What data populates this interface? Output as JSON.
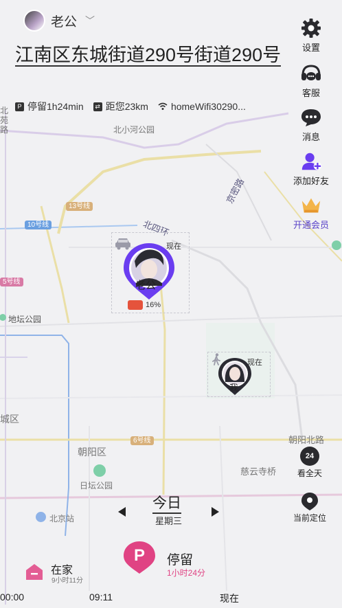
{
  "header": {
    "user_name": "老公",
    "address": "江南区东城街道290号街道290号",
    "info": {
      "stay": "停留1h24min",
      "distance": "距您23km",
      "wifi": "homeWifi30290..."
    }
  },
  "right_menu": [
    {
      "label": "设置",
      "icon": "gear-icon"
    },
    {
      "label": "客服",
      "icon": "headset-icon"
    },
    {
      "label": "消息",
      "icon": "chat-bubble-icon"
    },
    {
      "label": "添加好友",
      "icon": "add-friend-icon"
    },
    {
      "label": "开通会员",
      "icon": "crown-icon"
    }
  ],
  "map_labels": {
    "beixiaohe_park": "北小河公园",
    "line13": "13号线",
    "line10": "10号线",
    "line5": "5号线",
    "jingmi_road": "京密路",
    "north_4th_ring": "北四环",
    "ditan_park": "地坛公园",
    "line6": "6号线",
    "chaoyang_district": "朝阳区",
    "ritan_park": "日坛公园",
    "beijing_station": "北京站",
    "ciyun_temple_bridge": "慈云寺桥",
    "chaoyang_north_road": "朝阳北路",
    "district_left": "城区",
    "top_left_chars": "北",
    "top_left_chars2": "苑",
    "top_left_chars3": "路"
  },
  "markers": {
    "husband": {
      "name": "老公",
      "now": "现在",
      "battery": "16%",
      "mode_icon": "car-icon"
    },
    "me": {
      "name": "我",
      "now": "现在",
      "mode_icon": "walk-icon"
    }
  },
  "map_controls": {
    "all_day": {
      "label": "看全天",
      "badge": "24"
    },
    "locate": {
      "label": "当前定位"
    }
  },
  "date_nav": {
    "day": "今日",
    "weekday": "星期三"
  },
  "stay_card": {
    "title": "停留",
    "duration": "1小时24分",
    "pin_letter": "P"
  },
  "home_card": {
    "title": "在家",
    "duration": "9小时11分"
  },
  "timeline": {
    "start": "00:00",
    "mid": "09:11",
    "end": "现在"
  },
  "colors": {
    "accent_purple": "#6a3df0",
    "stay_pink": "#e04383",
    "battery_red": "#e5533c"
  }
}
